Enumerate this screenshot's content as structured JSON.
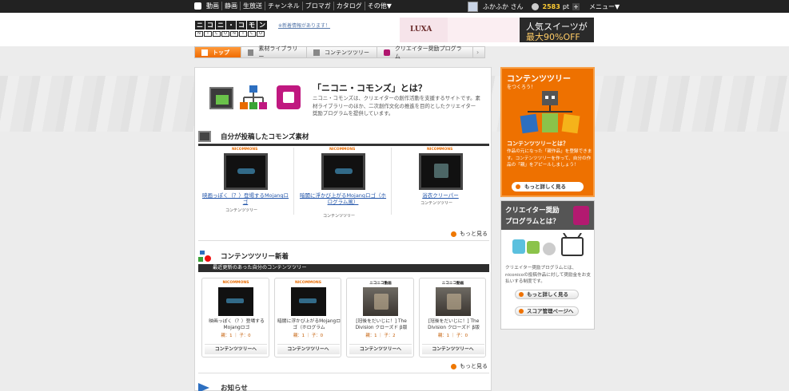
{
  "topbar": {
    "nav": [
      "動画",
      "静画",
      "生放送",
      "チャンネル",
      "ブロマガ",
      "カタログ",
      "その他▼"
    ],
    "username": "ふかふか さん",
    "points": "2583",
    "points_unit": "pt",
    "plus": "+",
    "menu": "メニュー▼"
  },
  "header": {
    "logo_top": [
      "ニ",
      "コ",
      "ニ",
      "・",
      "コ",
      "モ",
      "ン"
    ],
    "logo_bottom": [
      "N",
      "I",
      "C",
      "O",
      "N",
      "I",
      "C",
      "O"
    ],
    "link": "※新着情報があります！"
  },
  "ad": {
    "brand": "LUXA",
    "line1": "人気スイーツが",
    "line2": "最大90%OFF"
  },
  "tabs": [
    {
      "label": "トップ"
    },
    {
      "label": "素材ライブラリー"
    },
    {
      "label": "コンテンツツリー"
    },
    {
      "label": "クリエイター奨励プログラム"
    }
  ],
  "tab_arrow": "›",
  "intro": {
    "title": "「ニコニ・コモンズ」とは？",
    "text": "ニコニ・コモンズは、クリエイターの創作活動を支援するサイトです。素材ライブラリーのほか、二次創作文化の推進を目的としたクリエイター奨励プログラムを提供しています。"
  },
  "materials": {
    "title": "自分が投稿したコモンズ素材",
    "niconi_tag": "NICOMMONS",
    "tree_label": "コンテンツツリー",
    "items": [
      {
        "caption": "映画っぽく（？）登場するMojangロゴ"
      },
      {
        "caption": "暗闇に浮かび上がるMojangロゴ（ホログラム風）"
      },
      {
        "caption": "浴衣クリーパー"
      }
    ],
    "more": "もっと見る"
  },
  "tree": {
    "title": "コンテンツツリー新着",
    "subtitle": "最近更新のあった自分のコンテンツツリー",
    "button": "コンテンツツリーへ",
    "cards": [
      {
        "tag": "NICOMMONS",
        "title": "映画っぽく（？）登場するMojangロゴ",
        "stats": "親：1 ｜ 子：0"
      },
      {
        "tag": "NICOMMONS",
        "title": "暗闇に浮かび上がるMojangロゴ（ホログラム",
        "stats": "親：1 ｜ 子：0"
      },
      {
        "tag": "ニコニコ動画",
        "title": "[冠後をだいじに！] The Division クローズド β版",
        "stats": "親：1 ｜ 子：2"
      },
      {
        "tag": "ニコニコ動画",
        "title": "[冠後をだいじに！] The Division クローズド β版",
        "stats": "親：1 ｜ 子：0"
      }
    ],
    "more": "もっと見る"
  },
  "news": {
    "title": "お知らせ"
  },
  "sidebar": {
    "tree_box": {
      "title": "コンテンツツリー",
      "subtitle": "をつくろう！",
      "question": "コンテンツツリーとは？",
      "desc": "作品の元になった「親作品」を登録できます。コンテンツツリーを作って、自分の作品の「親」をアピールしましょう！",
      "button": "もっと詳しく見る"
    },
    "program_box": {
      "title1": "クリエイター奨励",
      "title2": "プログラムとは？",
      "desc": "クリエイター奨励プログラムとは、niconicoの投稿作品に対して奨励金をお支払いする制度です。",
      "button1": "もっと詳しく見る",
      "button2": "スコア管理ページへ"
    }
  },
  "colors": {
    "accent_orange": "#ee7100",
    "magenta": "#b31a70",
    "topbar": "#222222"
  }
}
